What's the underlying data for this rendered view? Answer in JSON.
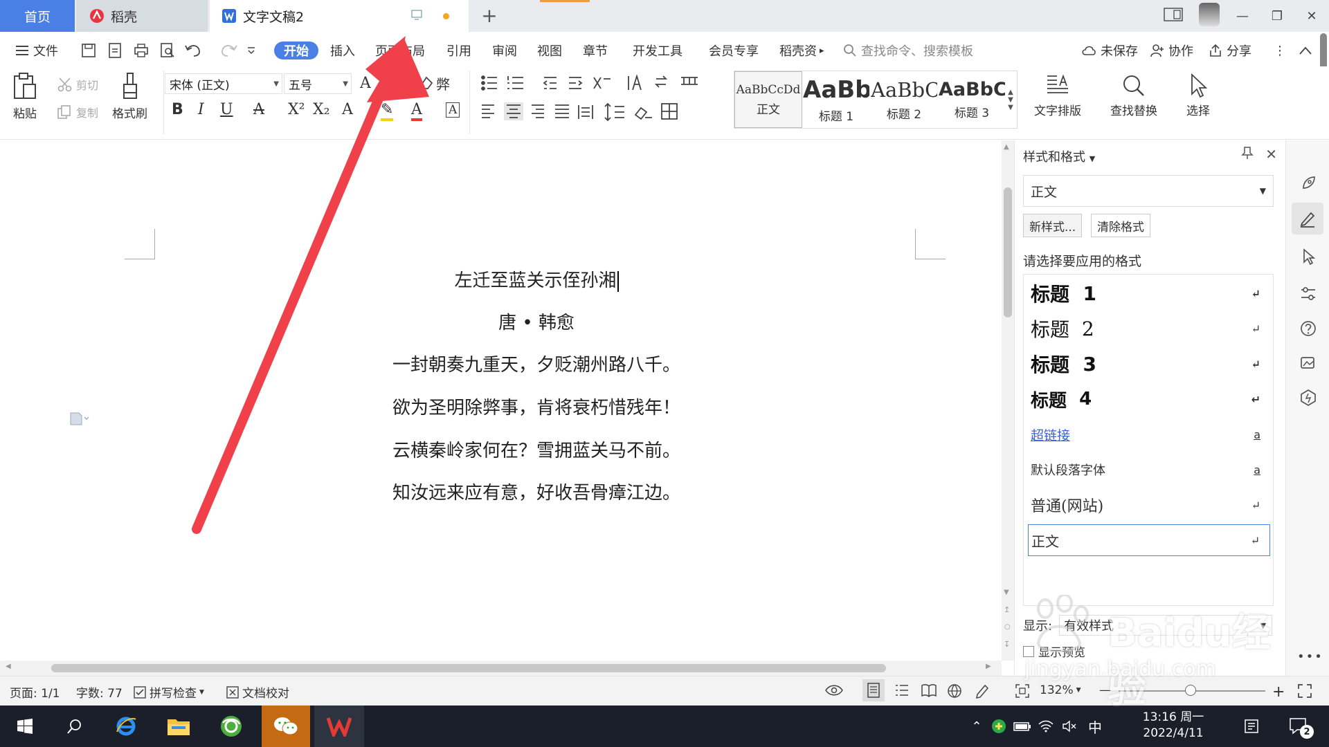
{
  "tabs": {
    "home": "首页",
    "daoke": "稻壳",
    "doc": "文字文稿2",
    "new_tab": "+"
  },
  "menu": {
    "file": "文件",
    "start": "开始",
    "insert": "插入",
    "layout": "页面布局",
    "reference": "引用",
    "review": "审阅",
    "view": "视图",
    "chapter": "章节",
    "devtools": "开发工具",
    "member": "会员专享",
    "daoke": "稻壳资",
    "search_placeholder": "查找命令、搜索模板",
    "unsaved": "未保存",
    "collab": "协作",
    "share": "分享"
  },
  "ribbon": {
    "paste": "粘贴",
    "cut": "剪切",
    "copy": "复制",
    "format_painter": "格式刷",
    "font_name": "宋体 (正文)",
    "font_size": "五号",
    "styles": [
      {
        "preview": "AaBbCcDd",
        "label": "正文"
      },
      {
        "preview": "AaBb",
        "label": "标题 1"
      },
      {
        "preview": "AaBbC",
        "label": "标题 2"
      },
      {
        "preview": "AaBbC",
        "label": "标题 3"
      }
    ],
    "text_layout": "文字排版",
    "find_replace": "查找替换",
    "select": "选择"
  },
  "document": {
    "lines": [
      "左迁至蓝关示侄孙湘",
      "唐 • 韩愈",
      "一封朝奏九重天，夕贬潮州路八千。",
      "欲为圣明除弊事，肯将衰朽惜残年！",
      "云横秦岭家何在？雪拥蓝关马不前。",
      "知汝远来应有意，好收吾骨瘴江边。"
    ]
  },
  "panel": {
    "title": "样式和格式",
    "current_style": "正文",
    "new_style": "新样式...",
    "clear_format": "清除格式",
    "choose_label": "请选择要应用的格式",
    "items": [
      {
        "name": "标题",
        "num": "1",
        "mark": "↵"
      },
      {
        "name": "标题",
        "num": "2",
        "mark": "↵"
      },
      {
        "name": "标题",
        "num": "3",
        "mark": "↵"
      },
      {
        "name": "标题",
        "num": "4",
        "mark": "↵"
      },
      {
        "name": "超链接",
        "mark": "a"
      },
      {
        "name": "默认段落字体",
        "mark": "a"
      },
      {
        "name": "普通(网站)",
        "mark": "↵"
      },
      {
        "name": "正文",
        "mark": "↵"
      }
    ],
    "show_label": "显示:",
    "show_value": "有效样式",
    "preview_label": "显示预览"
  },
  "status": {
    "page": "页面: 1/1",
    "words": "字数: 77",
    "spell": "拼写检查",
    "proof": "文档校对",
    "zoom": "132%"
  },
  "taskbar": {
    "ime": "中",
    "time": "13:16 周一",
    "date": "2022/4/11",
    "notif_count": "2"
  },
  "watermark": {
    "logo": "Baidu经验",
    "url": "jingyan.baidu.com"
  },
  "colors": {
    "accent": "#4a7fe6",
    "arrow": "#f0414a",
    "taskbar": "#1b1f2a"
  }
}
